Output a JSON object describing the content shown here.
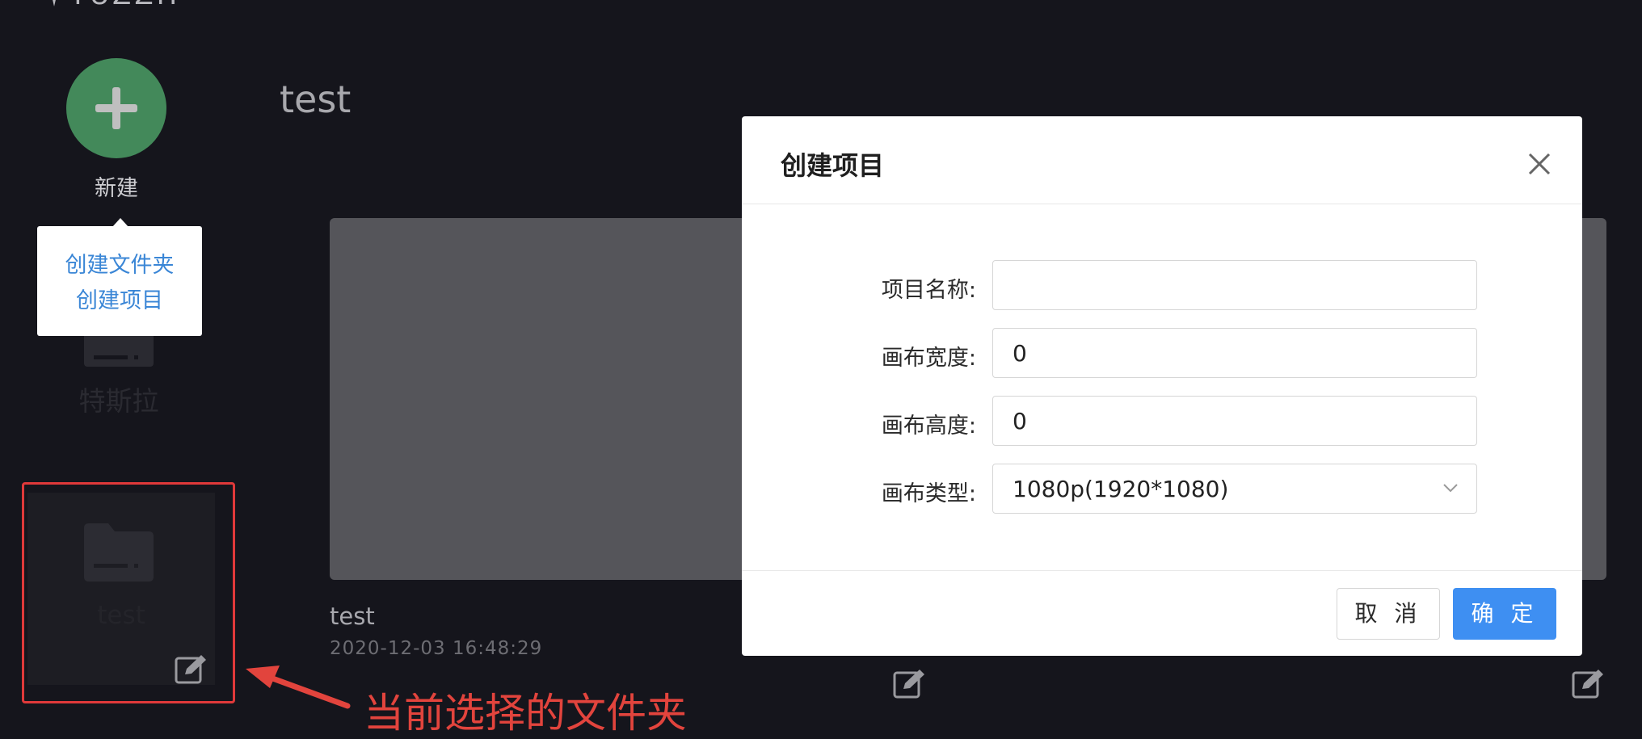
{
  "logo": {
    "text": "TUZZH"
  },
  "sidebar": {
    "new_label": "新建",
    "popover": {
      "items": [
        "创建文件夹",
        "创建项目"
      ]
    },
    "folders": [
      {
        "label": "特斯拉"
      },
      {
        "label": "test",
        "selected": true
      }
    ]
  },
  "main": {
    "folder_title": "test",
    "cards": [
      {
        "name": "test",
        "date": "2020-12-03 16:48:29"
      }
    ]
  },
  "modal": {
    "title": "创建项目",
    "fields": [
      {
        "label": "项目名称:",
        "value": ""
      },
      {
        "label": "画布宽度:",
        "value": "0"
      },
      {
        "label": "画布高度:",
        "value": "0"
      },
      {
        "label": "画布类型:",
        "value": "1080p(1920*1080)"
      }
    ],
    "cancel_label": "取 消",
    "ok_label": "确 定"
  },
  "annotation": {
    "text": "当前选择的文件夹"
  },
  "colors": {
    "background": "#15151c",
    "new_button": "#43895a",
    "popover_link": "#3a86d6",
    "annotation": "#e2443d",
    "primary_button": "#3e8ff2"
  },
  "icons": [
    "plus-icon",
    "folder-icon",
    "edit-icon",
    "close-icon",
    "chevron-down-icon",
    "arrow-annotation"
  ]
}
